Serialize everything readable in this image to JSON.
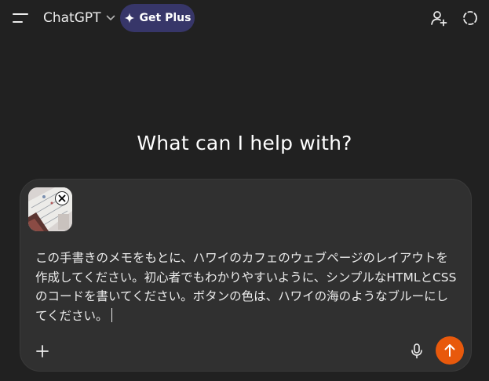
{
  "header": {
    "model_name": "ChatGPT",
    "get_plus_label": "Get Plus",
    "icons": [
      "sidebar-menu-icon",
      "chevron-down-icon",
      "sparkle-icon",
      "add-person-icon",
      "temporary-chat-icon"
    ]
  },
  "main": {
    "heading": "What can I help with?"
  },
  "composer": {
    "prompt": "この手書きのメモをもとに、ハワイのカフェのウェブページのレイアウトを作成してください。初心者でもわかりやすいように、シンプルなHTMLとCSSのコードを書いてください。ボタンの色は、ハワイの海のようなブルーにしてください。",
    "attachment_icon": "image-thumbnail",
    "remove_icon": "close-icon",
    "add_icon": "plus-icon",
    "mic_icon": "microphone-icon",
    "send_icon": "arrow-up-icon"
  },
  "colors": {
    "background": "#212121",
    "composer": "#303030",
    "get_plus_bg": "#373669",
    "send_button": "#e8590c"
  }
}
